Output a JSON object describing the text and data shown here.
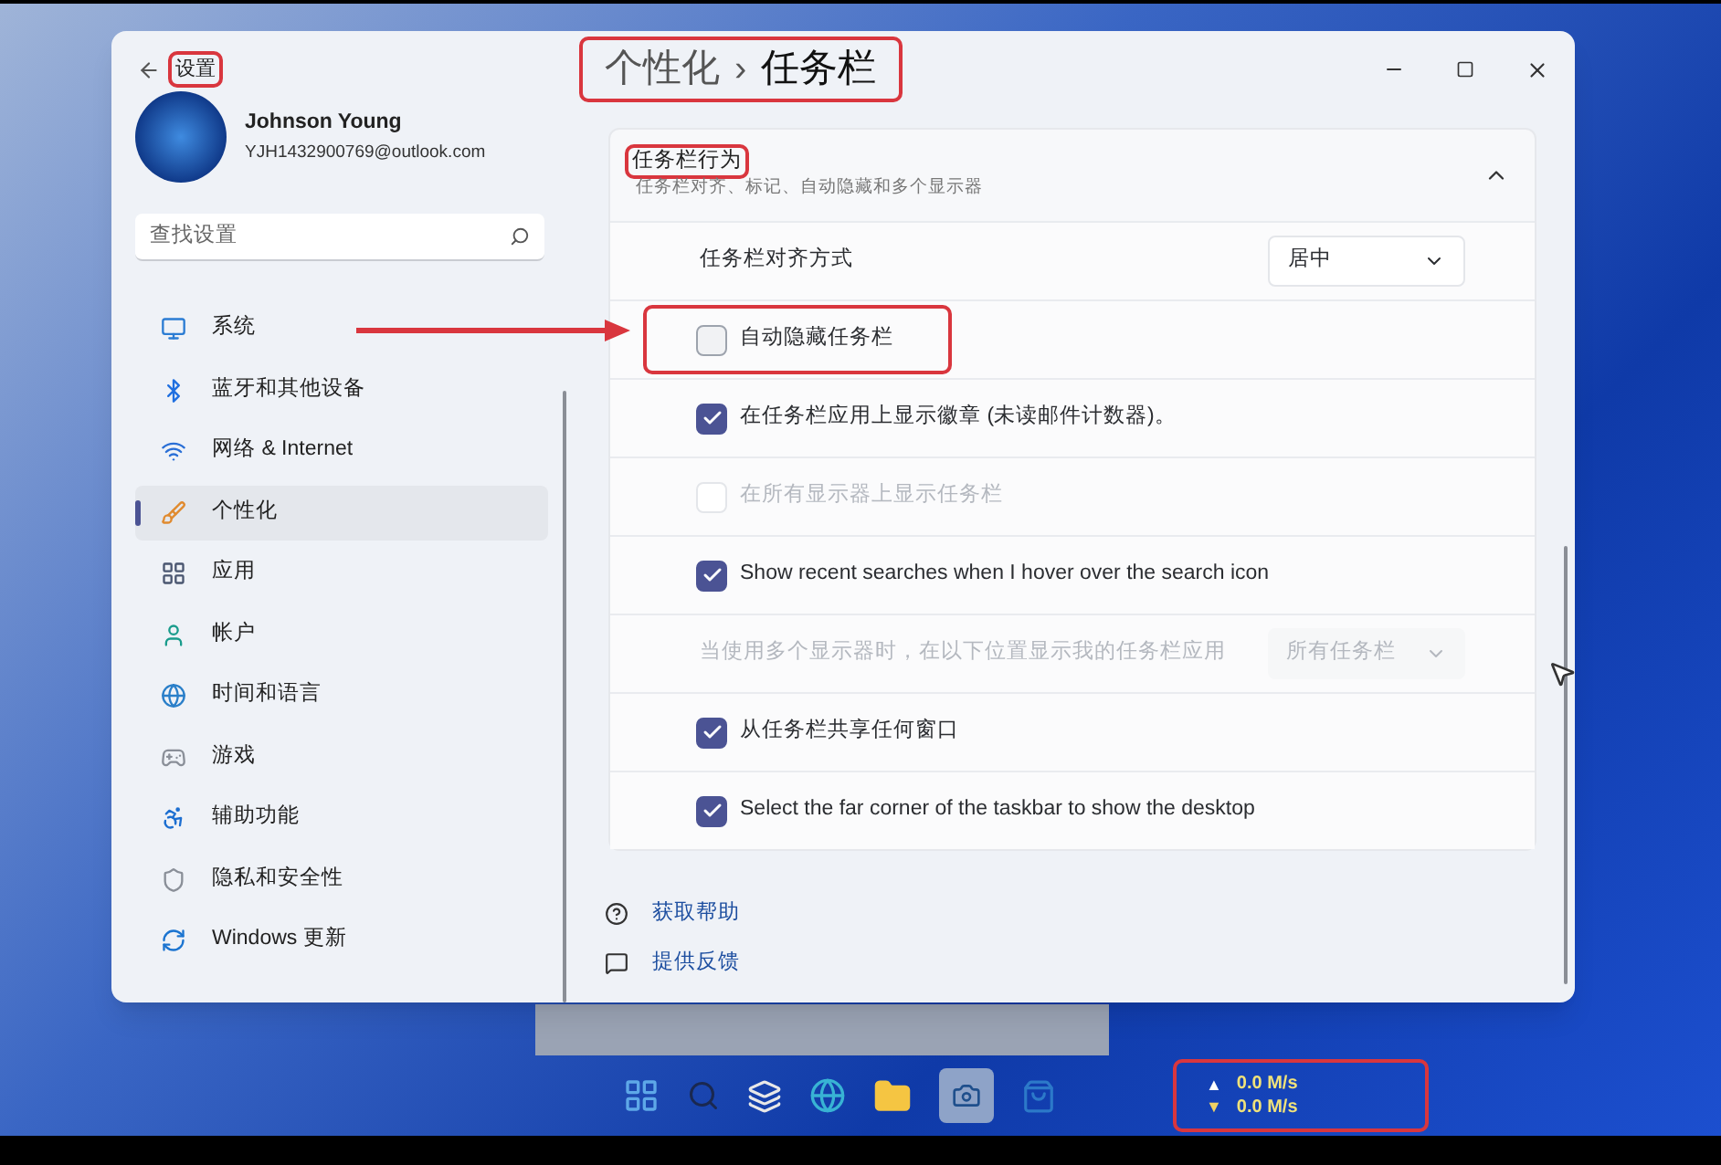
{
  "window": {
    "title": "设置",
    "title_highlighted": true
  },
  "breadcrumb": {
    "parent": "个性化",
    "separator": "›",
    "current": "任务栏",
    "highlighted": true
  },
  "user": {
    "name": "Johnson Young",
    "email": "YJH1432900769@outlook.com"
  },
  "search": {
    "placeholder": "查找设置"
  },
  "nav": [
    {
      "label": "系统",
      "selected": false
    },
    {
      "label": "蓝牙和其他设备",
      "selected": false
    },
    {
      "label": "网络 & Internet",
      "selected": false
    },
    {
      "label": "个性化",
      "selected": true
    },
    {
      "label": "应用",
      "selected": false
    },
    {
      "label": "帐户",
      "selected": false
    },
    {
      "label": "时间和语言",
      "selected": false
    },
    {
      "label": "游戏",
      "selected": false
    },
    {
      "label": "辅助功能",
      "selected": false
    },
    {
      "label": "隐私和安全性",
      "selected": false
    },
    {
      "label": "Windows 更新",
      "selected": false
    }
  ],
  "section": {
    "title": "任务栏行为",
    "title_highlighted": true,
    "subtitle": "任务栏对齐、标记、自动隐藏和多个显示器",
    "expanded": true
  },
  "settings": [
    {
      "kind": "dropdown",
      "label": "任务栏对齐方式",
      "value": "居中",
      "disabled": false,
      "highlighted": false
    },
    {
      "kind": "checkbox",
      "label": "自动隐藏任务栏",
      "checked": false,
      "disabled": false,
      "highlighted": true
    },
    {
      "kind": "checkbox",
      "label": "在任务栏应用上显示徽章 (未读邮件计数器)。",
      "checked": true,
      "disabled": false,
      "highlighted": false
    },
    {
      "kind": "checkbox",
      "label": "在所有显示器上显示任务栏",
      "checked": false,
      "disabled": true,
      "highlighted": false
    },
    {
      "kind": "checkbox",
      "label": "Show recent searches when I hover over the search icon",
      "checked": true,
      "disabled": false,
      "highlighted": false
    },
    {
      "kind": "dropdown",
      "label": "当使用多个显示器时，在以下位置显示我的任务栏应用",
      "value": "所有任务栏",
      "disabled": true,
      "highlighted": false
    },
    {
      "kind": "checkbox",
      "label": "从任务栏共享任何窗口",
      "checked": true,
      "disabled": false,
      "highlighted": false
    },
    {
      "kind": "checkbox",
      "label": "Select the far corner of the taskbar to show the desktop",
      "checked": true,
      "disabled": false,
      "highlighted": false
    }
  ],
  "links": [
    {
      "label": "获取帮助"
    },
    {
      "label": "提供反馈"
    }
  ],
  "taskbar": {
    "upload": "0.0 M/s",
    "download": "0.0 M/s",
    "upload_arrow": "▲",
    "download_arrow": "▼",
    "highlighted": true
  }
}
